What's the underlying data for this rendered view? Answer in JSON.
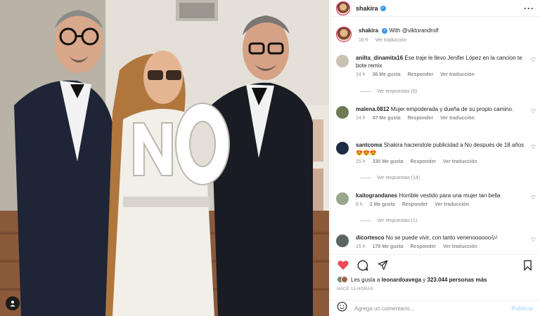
{
  "post": {
    "photo_alt": "Photo post",
    "header_username": "shakira"
  },
  "caption": {
    "username": "shakira",
    "text": "With @viktorandrolf",
    "time": "16 h",
    "translate": "Ver traducción"
  },
  "comments": [
    {
      "username": "anilta_dinamita16",
      "text": "Ese traje le llevo Jenifer López en la cancion te bote remix",
      "time": "14 h",
      "likes": "36 Me gusta",
      "reply": "Responder",
      "translate": "Ver traducción",
      "replies": "Ver respuestas (6)",
      "avatar_color": "#c9c1b3"
    },
    {
      "username": "malena.0812",
      "text": "Mujer empoderada y dueña de su propio camino.",
      "time": "14 h",
      "likes": "47 Me gusta",
      "reply": "Responder",
      "translate": "Ver traducción",
      "replies": "",
      "avatar_color": "#6f7a55"
    },
    {
      "username": "santcoma",
      "text": "Shakira haciendole publicidad a No después de 18 años 😍😍😍",
      "time": "15 h",
      "likes": "330 Me gusta",
      "reply": "Responder",
      "translate": "Ver traducción",
      "replies": "Ver respuestas (14)",
      "avatar_color": "#1f2a44"
    },
    {
      "username": "kaitograndanes",
      "text": "Horrible vestido para una mujer tan bella",
      "time": "8 h",
      "likes": "2 Me gusta",
      "reply": "Responder",
      "translate": "Ver traducción",
      "replies": "Ver respuestas (1)",
      "avatar_color": "#9aa58e"
    },
    {
      "username": "dicortesco",
      "text": "No se puede vivir, con tanto venenoooooo🎶",
      "time": "15 h",
      "likes": "179 Me gusta",
      "reply": "Responder",
      "translate": "Ver traducción",
      "replies": "",
      "avatar_color": "#5c6660"
    }
  ],
  "likes": {
    "prefix": "Les gusta a ",
    "user": "leonardoavega",
    "middle": " y ",
    "count": "323.044 personas más"
  },
  "timeago": "HACE 15 HORAS",
  "add_comment": {
    "placeholder": "Agrega un comentario...",
    "publish": "Publicar"
  },
  "icons": {
    "like": "heart-filled-icon",
    "comment": "comment-icon",
    "share": "paper-plane-icon",
    "save": "bookmark-icon",
    "more": "more-icon",
    "emoji": "emoji-icon",
    "user_tag": "user-tag-icon"
  },
  "colors": {
    "like_red": "#ed4956",
    "verified_blue": "#3897f0",
    "publish_disabled": "#b2dffc",
    "muted_text": "#8e8e8e"
  }
}
